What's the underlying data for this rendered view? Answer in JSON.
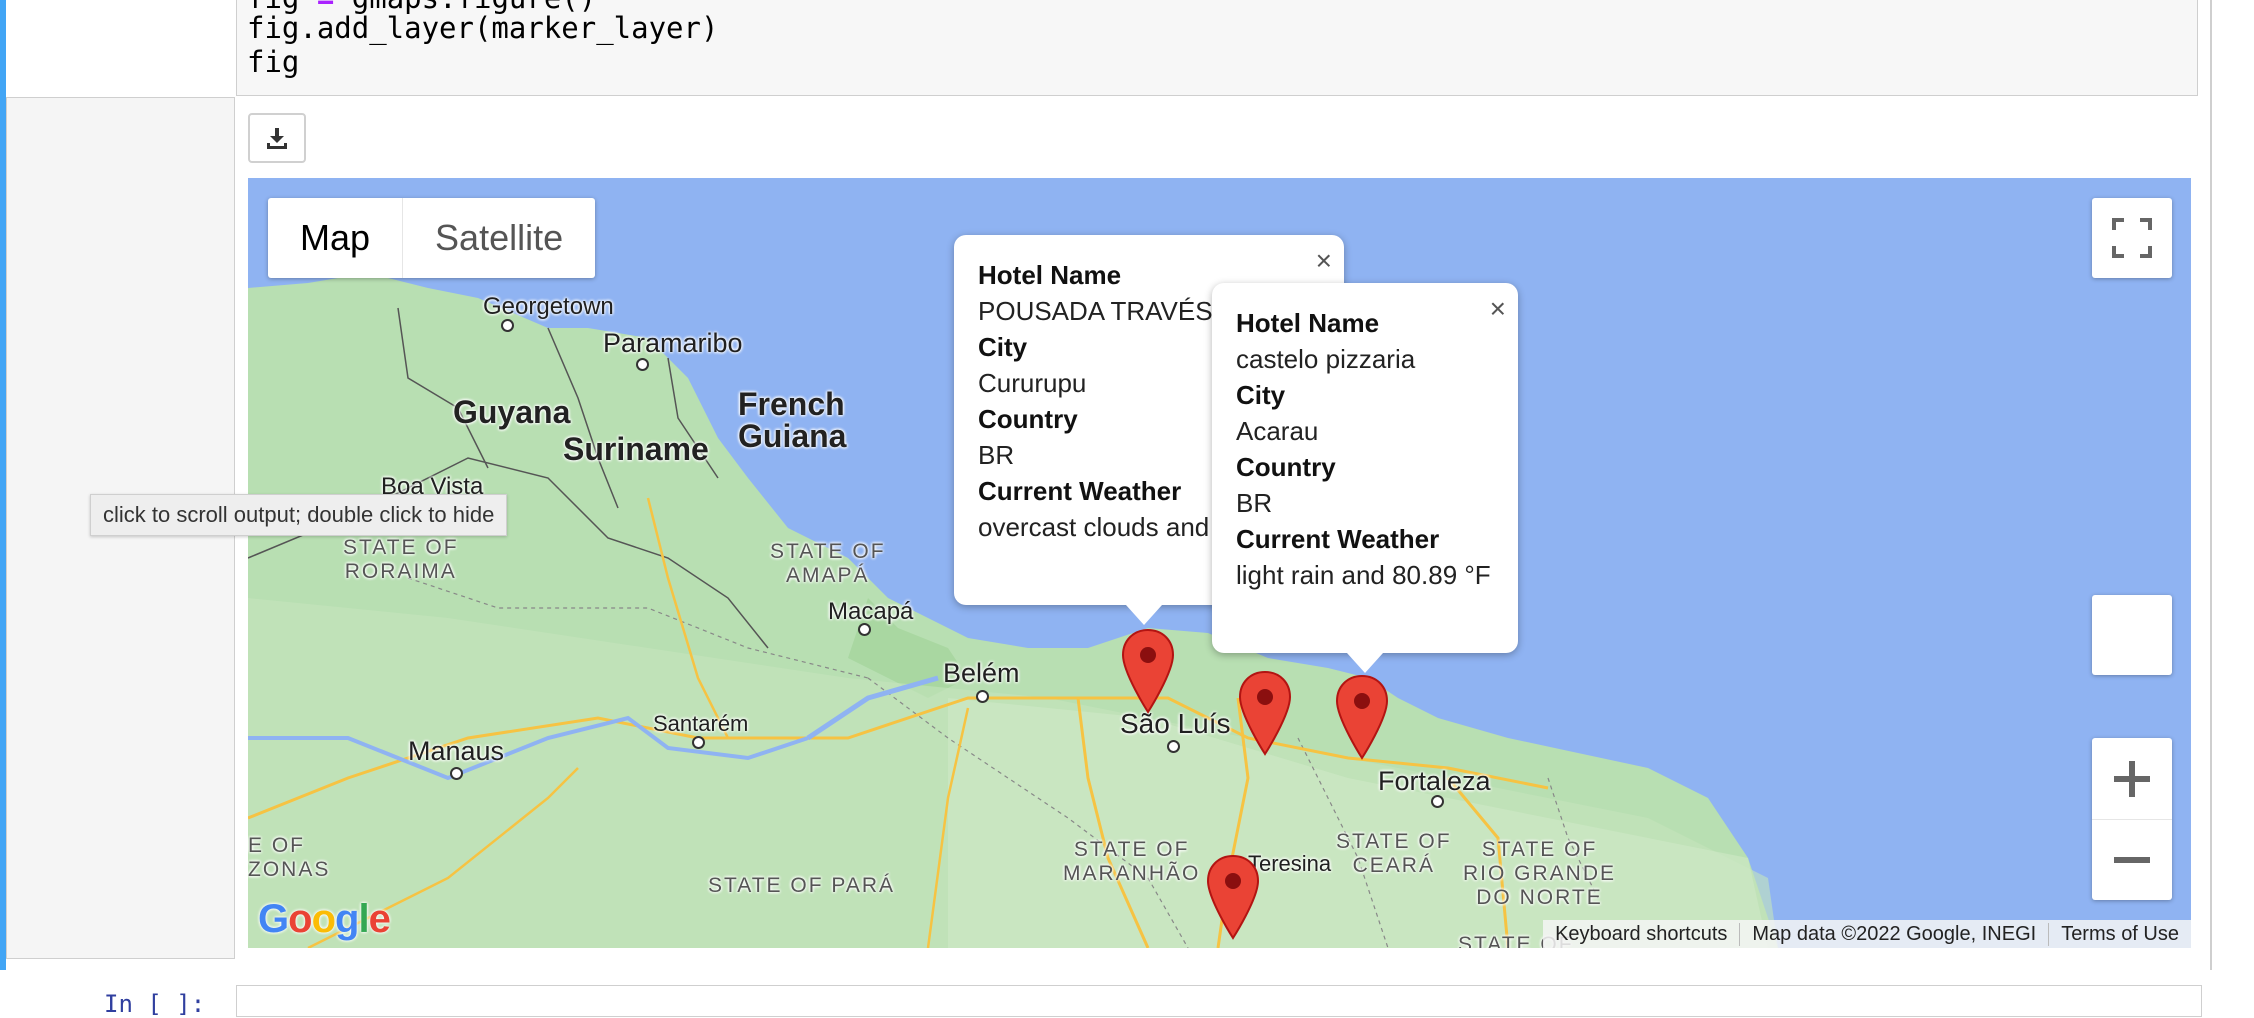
{
  "code": {
    "lines": [
      "fig = gmaps.figure()",
      "fig.add_layer(marker_layer)",
      "fig"
    ]
  },
  "output": {
    "download_icon": "download-icon",
    "tooltip": "click to scroll output; double click to hide"
  },
  "map": {
    "type_buttons": {
      "map": "Map",
      "satellite": "Satellite"
    },
    "labels": {
      "georgetown": "Georgetown",
      "paramaribo": "Paramaribo",
      "guyana": "Guyana",
      "french_guiana_1": "French",
      "french_guiana_2": "Guiana",
      "suriname": "Suriname",
      "boa_vista": "Boa Vista",
      "state_roraima": "STATE OF\nRORAIMA",
      "state_amapa": "STATE OF\nAMAPÁ",
      "macapa": "Macapá",
      "belem": "Belém",
      "santarem": "Santarém",
      "manaus": "Manaus",
      "sao_luis": "São Luís",
      "fortaleza": "Fortaleza",
      "teresina": "Teresina",
      "state_maranhao": "STATE OF\nMARANHÃO",
      "state_ceara": "STATE OF\nCEARÁ",
      "state_rn": "STATE OF\nRIO GRANDE\nDO NORTE",
      "state_para": "STATE OF PARÁ",
      "state_am": "E OF\nZONAS",
      "state_bottom": "STATE OF"
    },
    "infowindow_1": {
      "hotel_key": "Hotel Name",
      "hotel": "POUSADA TRAVÉS'O",
      "city_key": "City",
      "city": "Cururupu",
      "country_key": "Country",
      "country": "BR",
      "weather_key": "Current Weather",
      "weather": "overcast clouds and"
    },
    "infowindow_2": {
      "hotel_key": "Hotel Name",
      "hotel": "castelo pizzaria",
      "city_key": "City",
      "city": "Acarau",
      "country_key": "Country",
      "country": "BR",
      "weather_key": "Current Weather",
      "weather": "light rain and 80.89 °F"
    },
    "close_glyph": "×",
    "footer": {
      "shortcuts": "Keyboard shortcuts",
      "data": "Map data ©2022 Google, INEGI",
      "terms": "Terms of Use"
    },
    "google_logo": "Google",
    "colors": {
      "water": "#8fb3f2",
      "land": "#b8dfb2",
      "marker": "#ea4335"
    }
  },
  "next_cell": {
    "prompt": "In [ ]:"
  }
}
